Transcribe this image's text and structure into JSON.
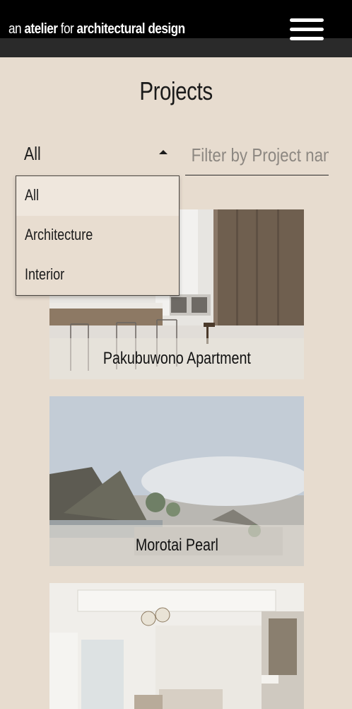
{
  "header": {
    "brand_prefix": "an",
    "brand_word1": "atelier",
    "brand_mid": "for",
    "brand_word2": "architectural design",
    "menu_icon": "hamburger-menu-icon"
  },
  "page": {
    "title": "Projects"
  },
  "filters": {
    "category_selected": "All",
    "category_options": [
      "All",
      "Architecture",
      "Interior"
    ],
    "search_placeholder": "Filter by Project name",
    "caret_icon": "caret-up-icon"
  },
  "projects": [
    {
      "name": "Pakubuwono Apartment"
    },
    {
      "name": "Morotai Pearl"
    },
    {
      "name": ""
    }
  ],
  "colors": {
    "page_bg": "#e7dccf",
    "header_bg": "#000000",
    "text": "#1b1b1b"
  }
}
